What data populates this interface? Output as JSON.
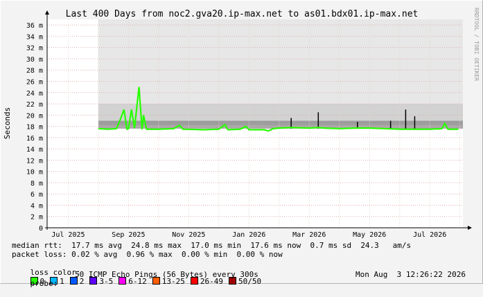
{
  "chart_data": {
    "type": "area",
    "title": "Last 400 Days from noc2.gva20.ip-max.net to as01.bdx01.ip-max.net",
    "ylabel": "Seconds",
    "xlabel": "",
    "watermark": "RRDTOOL / TOBI OETIKER",
    "ylim": [
      0,
      37
    ],
    "y_ticks": [
      "0",
      "2 m",
      "4 m",
      "6 m",
      "8 m",
      "10 m",
      "12 m",
      "14 m",
      "16 m",
      "18 m",
      "20 m",
      "22 m",
      "24 m",
      "26 m",
      "28 m",
      "30 m",
      "32 m",
      "34 m",
      "36 m"
    ],
    "y_tick_values": [
      0,
      2,
      4,
      6,
      8,
      10,
      12,
      14,
      16,
      18,
      20,
      22,
      24,
      26,
      28,
      30,
      32,
      34,
      36
    ],
    "x_ticks": [
      "Jul 2025",
      "Sep 2025",
      "Nov 2025",
      "Jan 2026",
      "Mar 2026",
      "May 2026",
      "Jul 2026"
    ],
    "x_tick_months": [
      0,
      2,
      4,
      6,
      8,
      10,
      12
    ],
    "x_start_month": -0.7,
    "x_end_month": 13.1,
    "data_start_month": 1.0,
    "grid": true,
    "series": [
      {
        "name": "median rtt",
        "unit": "ms",
        "points": [
          [
            1.0,
            17.6
          ],
          [
            1.3,
            17.5
          ],
          [
            1.6,
            17.6
          ],
          [
            1.75,
            19.5
          ],
          [
            1.85,
            21.0
          ],
          [
            1.95,
            17.5
          ],
          [
            2.0,
            17.6
          ],
          [
            2.1,
            21.0
          ],
          [
            2.2,
            17.7
          ],
          [
            2.35,
            25.0
          ],
          [
            2.45,
            17.5
          ],
          [
            2.5,
            20.0
          ],
          [
            2.6,
            17.5
          ],
          [
            3.0,
            17.5
          ],
          [
            3.5,
            17.6
          ],
          [
            3.7,
            18.2
          ],
          [
            3.8,
            17.5
          ],
          [
            4.5,
            17.4
          ],
          [
            5.0,
            17.5
          ],
          [
            5.2,
            18.3
          ],
          [
            5.3,
            17.4
          ],
          [
            5.7,
            17.5
          ],
          [
            5.9,
            18.0
          ],
          [
            6.0,
            17.4
          ],
          [
            6.5,
            17.4
          ],
          [
            6.65,
            17.2
          ],
          [
            6.8,
            17.6
          ],
          [
            7.0,
            17.7
          ],
          [
            7.4,
            17.8
          ],
          [
            8.0,
            17.7
          ],
          [
            8.3,
            17.8
          ],
          [
            8.5,
            17.7
          ],
          [
            9.0,
            17.6
          ],
          [
            9.5,
            17.7
          ],
          [
            10.0,
            17.7
          ],
          [
            10.5,
            17.6
          ],
          [
            11.0,
            17.5
          ],
          [
            11.5,
            17.5
          ],
          [
            12.0,
            17.5
          ],
          [
            12.4,
            17.6
          ],
          [
            12.5,
            18.5
          ],
          [
            12.6,
            17.5
          ],
          [
            12.95,
            17.5
          ]
        ]
      }
    ],
    "spikes": [
      [
        7.4,
        19.5
      ],
      [
        8.3,
        20.5
      ],
      [
        9.6,
        18.8
      ],
      [
        10.3,
        17.7
      ],
      [
        10.7,
        19.0
      ],
      [
        11.2,
        21.0
      ],
      [
        11.5,
        19.8
      ]
    ]
  },
  "legend": {
    "median_rtt_line": "median rtt:  17.7 ms avg  24.8 ms max  17.0 ms min  17.6 ms now  0.7 ms sd  24.3   am/s",
    "packet_loss_line": "packet loss: 0.02 % avg  0.96 % max  0.00 % min  0.00 % now",
    "loss_color_label": "loss color:",
    "loss_colors": [
      {
        "label": "0",
        "color": "#26ff00"
      },
      {
        "label": "1",
        "color": "#00b8ff"
      },
      {
        "label": "2",
        "color": "#0059ff"
      },
      {
        "label": "3-5",
        "color": "#5e00ff"
      },
      {
        "label": "6-12",
        "color": "#ff00f6"
      },
      {
        "label": "13-25",
        "color": "#ff5e00"
      },
      {
        "label": "26-49",
        "color": "#ff0000"
      },
      {
        "label": "50/50",
        "color": "#a10000"
      }
    ],
    "probe_label": "probe:",
    "probe_text": "50 ICMP Echo Pings (56 Bytes) every 300s",
    "timestamp": "Mon Aug  3 12:26:22 2026"
  },
  "colors": {
    "grid_major": "#e6aaaa",
    "grid_minor": "#e6d2d2",
    "smoke": "#d4d4d4",
    "rtt_line": "#26ff00",
    "canvas": "#ffffff",
    "background": "#f3f3f3"
  }
}
